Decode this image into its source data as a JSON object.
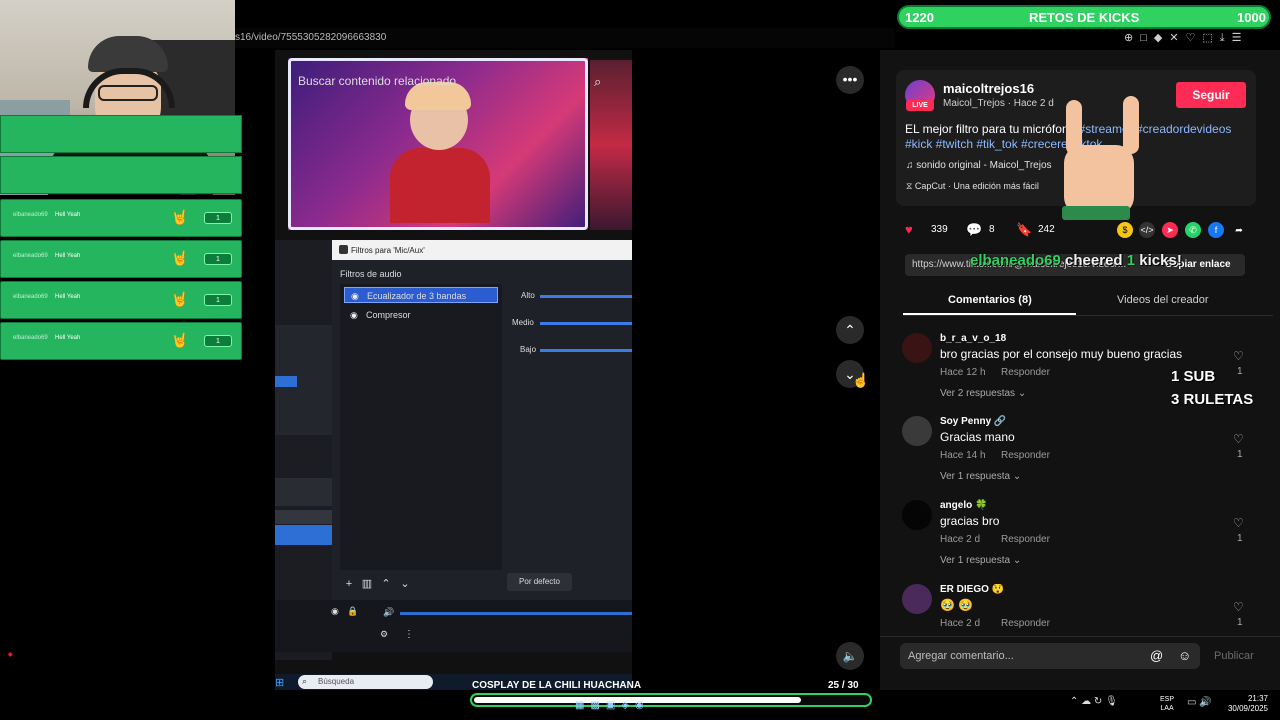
{
  "browser": {
    "url_fragment": "s16/video/7555305282096663830",
    "toolbar_icons": [
      "zoom-icon",
      "screenshot-icon",
      "shield-icon",
      "translate-icon",
      "heart-icon",
      "extensions-icon",
      "download-icon",
      "menu-icon"
    ]
  },
  "goal": {
    "start": "1220",
    "title": "RETOS DE KICKS",
    "end": "1000"
  },
  "alerts": {
    "items": [
      {
        "user": "elbaneado69",
        "message": "Hell Yeah",
        "badge": "1"
      },
      {
        "user": "elbaneado69",
        "message": "Hell Yeah",
        "badge": "1"
      },
      {
        "user": "elbaneado69",
        "message": "Hell Yeah",
        "badge": "1"
      },
      {
        "user": "elbaneado69",
        "message": "Hell Yeah",
        "badge": "1"
      }
    ]
  },
  "video": {
    "search_overlay": "Buscar contenido relacionado",
    "obs": {
      "dialog_title": "Filtros para 'Mic/Aux'",
      "section": "Filtros de audio",
      "filters": [
        "Ecualizador de 3 bandas",
        "Compresor"
      ],
      "eq_labels": [
        "Alto",
        "Medio",
        "Bajo"
      ],
      "reset_button": "Por defecto"
    },
    "taskbar_search": "Búsqueda"
  },
  "post": {
    "username": "maicoltrejos16",
    "live_badge": "LIVE",
    "subline": "Maicol_Trejos · Hace 2 d",
    "follow_label": "Seguir",
    "description_plain": "EL mejor filtro para tu micrófono ",
    "description_tags_1": "#streamer #creadordevideos",
    "description_tags_2": "#kick #twitch #tik_tok #crecerentiktok",
    "sound": "sonido original - Maicol_Trejos",
    "capcut": "CapCut · Una edición más fácil",
    "likes": "339",
    "comments": "8",
    "saves": "242",
    "link": "https://www.tiktok.com/@maicoltrejos16/video/...",
    "copy_label": "Copiar enlace"
  },
  "cheer_overlay": {
    "user": "elbaneado69",
    "action": "cheered",
    "amount": "1",
    "unit": "kicks!"
  },
  "tabs": {
    "comments": "Comentarios (8)",
    "creator_videos": "Videos del creador"
  },
  "comments": [
    {
      "user": "b_r_a_v_o_18",
      "text": "bro gracias por el consejo muy bueno gracias",
      "time": "Hace 12 h",
      "reply": "Responder",
      "more": "Ver 2 respuestas",
      "likes": "1",
      "avatar_color": "#3a1414"
    },
    {
      "user": "Soy Penny 🔗",
      "text": "Gracias mano",
      "time": "Hace 14 h",
      "reply": "Responder",
      "more": "Ver 1 respuesta",
      "likes": "1",
      "avatar_color": "#3a3a3a"
    },
    {
      "user": "angelo 🍀",
      "text": "gracias bro",
      "time": "Hace 2 d",
      "reply": "Responder",
      "more": "Ver 1 respuesta",
      "likes": "1",
      "avatar_color": "#050505"
    },
    {
      "user": "ER DIEGO 😲",
      "text": "🥹 🥹",
      "time": "Hace 2 d",
      "reply": "Responder",
      "more": "",
      "likes": "1",
      "avatar_color": "#4a2a5a"
    }
  ],
  "overlay_rewards": {
    "line1": "1 SUB",
    "line2": "3 RULETAS"
  },
  "comment_input": {
    "placeholder": "Agregar comentario...",
    "post_label": "Publicar"
  },
  "bottom": {
    "title": "COSPLAY DE LA CHILI HUACHANA",
    "count": "25  / 30",
    "progress": 0.83
  },
  "taskbar": {
    "lang_1": "ESP",
    "lang_2": "LAA",
    "time": "21:37",
    "date": "30/09/2025"
  }
}
